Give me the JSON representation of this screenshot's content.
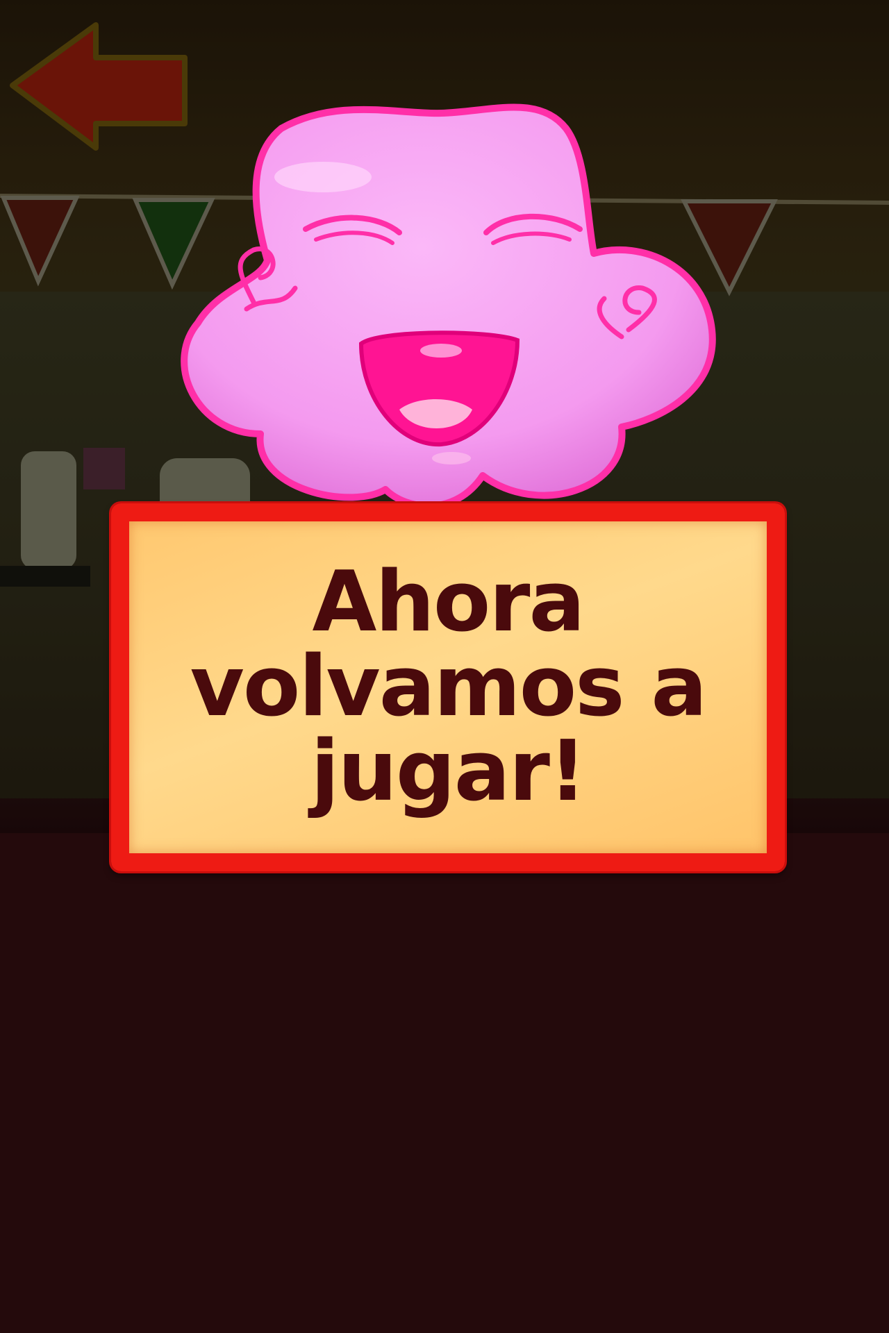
{
  "dialog": {
    "message": "Ahora volvamos a jugar!"
  },
  "icons": {
    "back": "back-arrow-icon",
    "character": "pink-blob-character"
  },
  "colors": {
    "panel_border": "#ee1b14",
    "panel_fill": "#ffd98c",
    "message_text": "#4a0a0c",
    "character_pink": "#f7a3f3",
    "character_outline": "#ff2fa8",
    "background": "#240a0c"
  }
}
